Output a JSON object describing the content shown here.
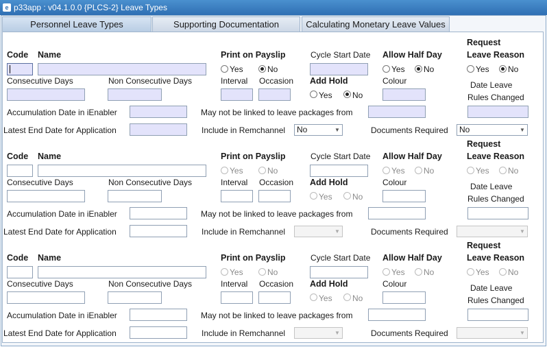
{
  "window": {
    "title": "p33app : v04.1.0.0  {PLCS-2} Leave Types",
    "icon": "app-icon"
  },
  "tabs": [
    {
      "label": "Personnel Leave Types",
      "active": true
    },
    {
      "label": "Supporting Documentation",
      "active": false
    },
    {
      "label": "Calculating Monetary Leave Values",
      "active": false
    }
  ],
  "labels": {
    "code": "Code",
    "name": "Name",
    "print_on_payslip": "Print on Payslip",
    "cycle_start_date": "Cycle Start Date",
    "allow_half_day": "Allow Half Day",
    "request": "Request",
    "leave_reason": "Leave Reason",
    "yes": "Yes",
    "no": "No",
    "consecutive_days": "Consecutive Days",
    "non_consecutive_days": "Non Consecutive Days",
    "interval": "Interval",
    "occasion": "Occasion",
    "add_hold": "Add Hold",
    "colour": "Colour",
    "date_leave": "Date Leave",
    "rules_changed": "Rules Changed",
    "accumulation_date": "Accumulation Date in iEnabler",
    "not_linked": "May not be linked to leave packages from",
    "latest_end_date": "Latest End Date for Application",
    "include_remchannel": "Include in Remchannel",
    "documents_required": "Documents Required"
  },
  "records": [
    {
      "enabled": true,
      "print_on_payslip": "No",
      "allow_half_day": "No",
      "leave_reason": "No",
      "add_hold": "No",
      "include_remchannel": "No",
      "documents_required": "No"
    },
    {
      "enabled": false,
      "print_on_payslip": "",
      "allow_half_day": "",
      "leave_reason": "",
      "add_hold": "",
      "include_remchannel": "",
      "documents_required": ""
    },
    {
      "enabled": false,
      "print_on_payslip": "",
      "allow_half_day": "",
      "leave_reason": "",
      "add_hold": "",
      "include_remchannel": "",
      "documents_required": ""
    }
  ]
}
